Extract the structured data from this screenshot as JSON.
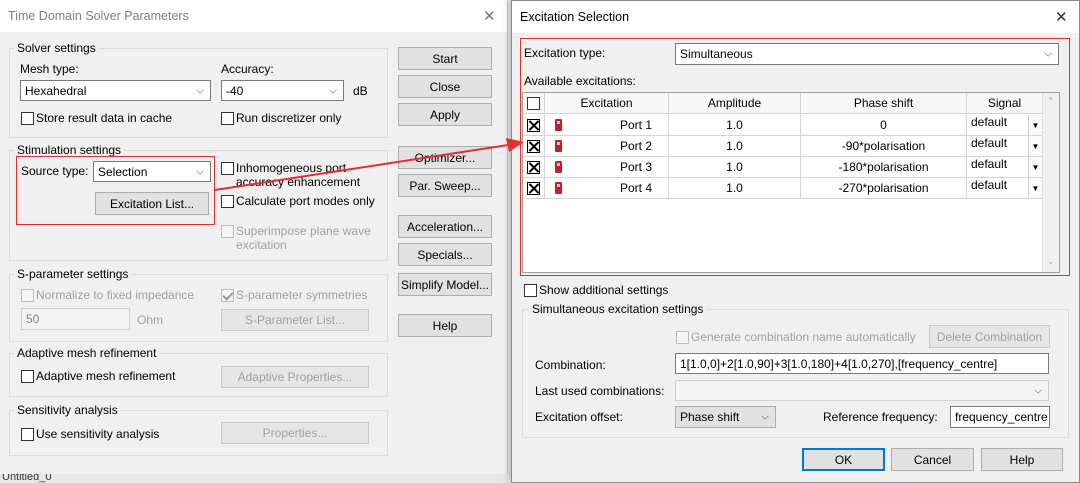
{
  "left_window": {
    "title": "Time Domain Solver Parameters",
    "close_glyph": "✕",
    "solver_settings": {
      "group_label": "Solver settings",
      "mesh_type_label": "Mesh type:",
      "mesh_type_value": "Hexahedral",
      "accuracy_label": "Accuracy:",
      "accuracy_value": "-40",
      "accuracy_unit": "dB",
      "store_result_label": "Store result data in cache",
      "run_discretizer_label": "Run discretizer only"
    },
    "stimulation_settings": {
      "group_label": "Stimulation settings",
      "source_type_label": "Source type:",
      "source_type_value": "Selection",
      "excitation_list_button": "Excitation List...",
      "inhomogeneous_label_1": "Inhomogeneous port",
      "inhomogeneous_label_2": "accuracy enhancement",
      "calc_port_modes_label": "Calculate port modes only",
      "superimpose_label_1": "Superimpose plane wave",
      "superimpose_label_2": "excitation"
    },
    "sparameter_settings": {
      "group_label": "S-parameter settings",
      "normalize_label": "Normalize to fixed impedance",
      "symmetries_label": "S-parameter symmetries",
      "impedance_value": "50",
      "impedance_unit": "Ohm",
      "sparam_list_button": "S-Parameter List..."
    },
    "adaptive_mesh": {
      "group_label": "Adaptive mesh refinement",
      "checkbox_label": "Adaptive mesh refinement",
      "properties_button": "Adaptive Properties..."
    },
    "sensitivity": {
      "group_label": "Sensitivity analysis",
      "checkbox_label": "Use sensitivity analysis",
      "properties_button": "Properties..."
    },
    "side_buttons": {
      "start": "Start",
      "close": "Close",
      "apply": "Apply",
      "optimizer": "Optimizer...",
      "par_sweep": "Par. Sweep...",
      "acceleration": "Acceleration...",
      "specials": "Specials...",
      "simplify_model": "Simplify Model...",
      "help": "Help"
    },
    "taskbar_text": "Untitled_0"
  },
  "right_window": {
    "title": "Excitation Selection",
    "close_glyph": "✕",
    "excitation_type_label": "Excitation type:",
    "excitation_type_value": "Simultaneous",
    "available_label": "Available excitations:",
    "table": {
      "headers": {
        "excitation": "Excitation",
        "amplitude": "Amplitude",
        "phase": "Phase shift",
        "signal": "Signal"
      },
      "rows": [
        {
          "port": "Port 1",
          "amplitude": "1.0",
          "phase": "0",
          "signal": "default"
        },
        {
          "port": "Port 2",
          "amplitude": "1.0",
          "phase": "-90*polarisation",
          "signal": "default"
        },
        {
          "port": "Port 3",
          "amplitude": "1.0",
          "phase": "-180*polarisation",
          "signal": "default"
        },
        {
          "port": "Port 4",
          "amplitude": "1.0",
          "phase": "-270*polarisation",
          "signal": "default"
        }
      ]
    },
    "show_additional_label": "Show additional settings",
    "simultaneous_group_label": "Simultaneous excitation settings",
    "generate_name_label": "Generate combination name automatically",
    "delete_combination_button": "Delete Combination",
    "combination_label": "Combination:",
    "combination_value": "1[1.0,0]+2[1.0,90]+3[1.0,180]+4[1.0,270],[frequency_centre]",
    "last_used_label": "Last used combinations:",
    "excitation_offset_label": "Excitation offset:",
    "excitation_offset_value": "Phase shift",
    "reference_frequency_label": "Reference frequency:",
    "reference_frequency_value": "frequency_centre",
    "ok_button": "OK",
    "cancel_button": "Cancel",
    "help_button": "Help"
  },
  "colors": {
    "annotation_red": "#e03030",
    "focus_blue": "#0078d7",
    "port_icon": "#c81e2a"
  }
}
